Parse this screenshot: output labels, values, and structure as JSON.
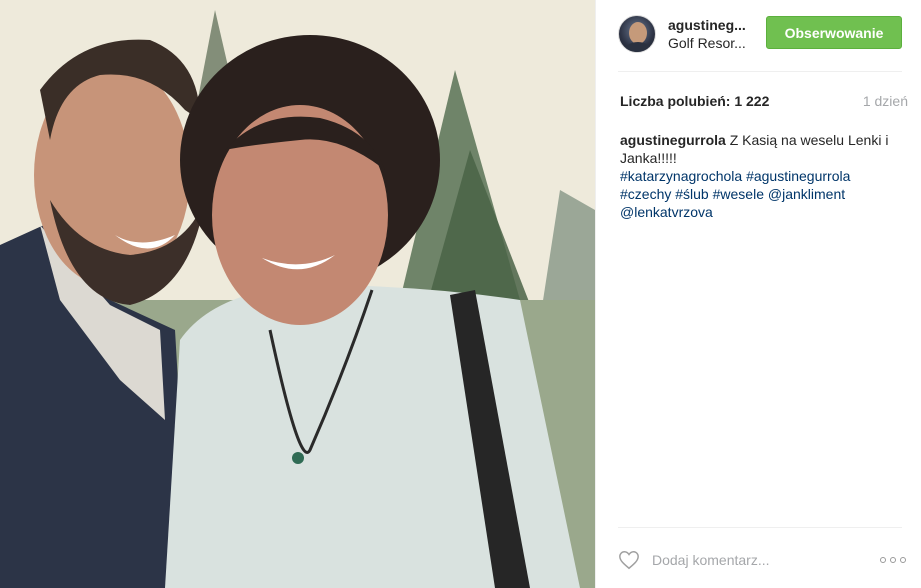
{
  "post": {
    "author": {
      "username": "agustineg...",
      "location": "Golf Resor..."
    },
    "follow_button_label": "Obserwowanie",
    "likes_text": "Liczba polubień: 1 222",
    "age": "1 dzień",
    "caption": {
      "author": "agustinegurrola",
      "text": "Z Kasią na weselu Lenki i Janka!!!!!",
      "tags": [
        "#katarzynagrochola",
        "#agustinegurrola",
        "#czechy",
        "#ślub",
        "#wesele",
        "@jankliment",
        "@lenkatvrzova"
      ]
    },
    "comment": {
      "placeholder": "Dodaj komentarz..."
    }
  },
  "icons": {
    "like": "heart-icon",
    "more": "more-options-icon"
  },
  "colors": {
    "follow_button": "#70c050",
    "link": "#003569",
    "muted": "#a5a7aa"
  }
}
